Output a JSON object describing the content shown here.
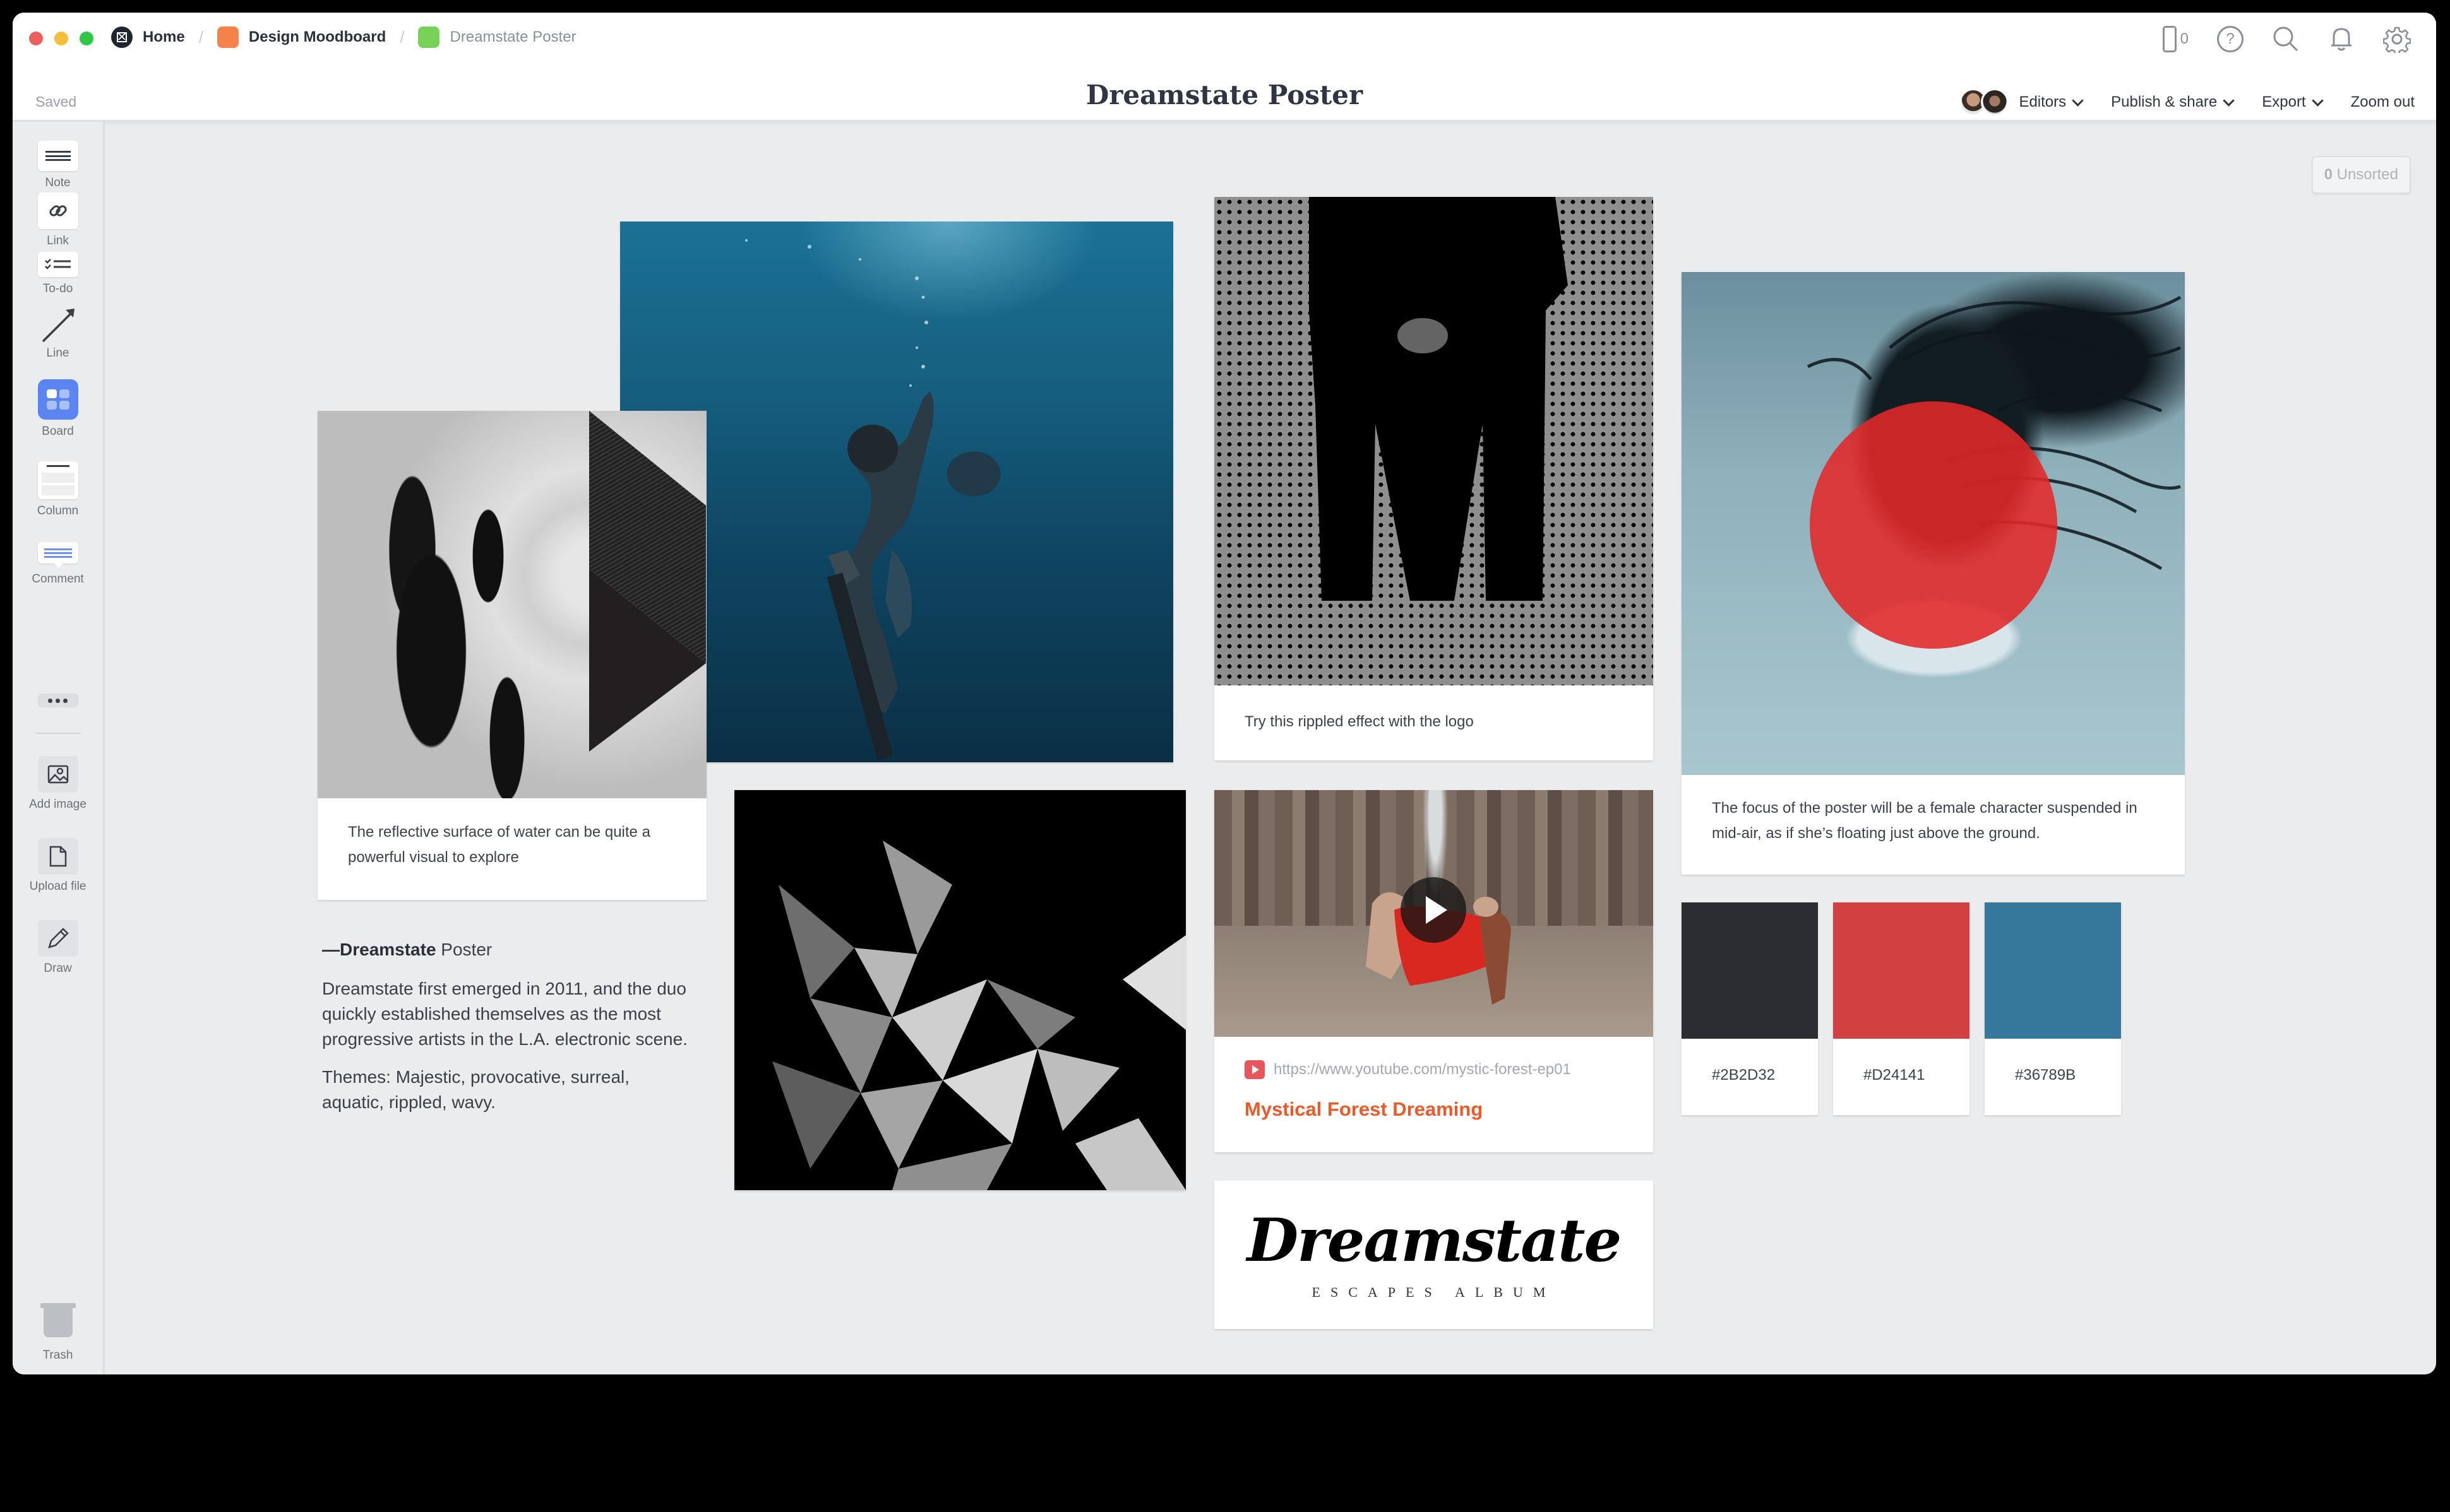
{
  "window": {
    "breadcrumbs": [
      {
        "label": "Home",
        "icon": "milanote-logo-icon",
        "color": "#1F2630"
      },
      {
        "label": "Design Moodboard",
        "icon": "board-icon",
        "color": "#F5824A"
      },
      {
        "label": "Dreamstate Poster",
        "icon": "board-icon",
        "color": "#78D25A"
      }
    ],
    "status": "Saved",
    "title": "Dreamstate Poster",
    "top_icons": {
      "phone_count": "0",
      "help": "?"
    },
    "toolbar": {
      "editors": "Editors",
      "publish": "Publish & share",
      "export": "Export",
      "zoom_out": "Zoom out"
    }
  },
  "sidebar": {
    "tools": [
      {
        "label": "Note",
        "icon": "note-icon"
      },
      {
        "label": "Link",
        "icon": "link-icon"
      },
      {
        "label": "To-do",
        "icon": "todo-icon"
      },
      {
        "label": "Line",
        "icon": "line-arrow-icon"
      },
      {
        "label": "Board",
        "icon": "board-icon"
      },
      {
        "label": "Column",
        "icon": "column-icon"
      },
      {
        "label": "Comment",
        "icon": "comment-icon"
      },
      {
        "label": "More",
        "icon": "more-icon"
      },
      {
        "label": "Add image",
        "icon": "image-icon"
      },
      {
        "label": "Upload file",
        "icon": "file-icon"
      },
      {
        "label": "Draw",
        "icon": "pencil-icon"
      }
    ],
    "trash": "Trash"
  },
  "canvas": {
    "unsorted": {
      "count": "0",
      "label": "Unsorted"
    },
    "hand_card": {
      "caption": "The reflective surface of water can be quite a powerful visual to explore"
    },
    "halftone_card": {
      "caption": "Try this rippled effect with the logo"
    },
    "video_card": {
      "url": "https://www.youtube.com/mystic-forest-ep01",
      "title": "Mystical Forest Dreaming"
    },
    "logo_card": {
      "word": "Dreamstate",
      "subtitle": "ESCAPES ALBUM"
    },
    "woman_card": {
      "caption": "The focus of the poster will be a female character suspended in mid-air, as if  she’s floating just above the ground."
    },
    "swatches": [
      {
        "hex": "#2B2D32",
        "color": "#2B2D32"
      },
      {
        "hex": "#D24141",
        "color": "#D24141"
      },
      {
        "hex": "#36789B",
        "color": "#36789B"
      }
    ],
    "note": {
      "dash": "—",
      "bold": "Dreamstate",
      "rest": " Poster",
      "p1": "Dreamstate first emerged in 2011, and the duo quickly established themselves as the most progressive artists in the L.A. electronic scene.",
      "p2": "Themes: Majestic, provocative, surreal, aquatic, rippled, wavy."
    }
  }
}
